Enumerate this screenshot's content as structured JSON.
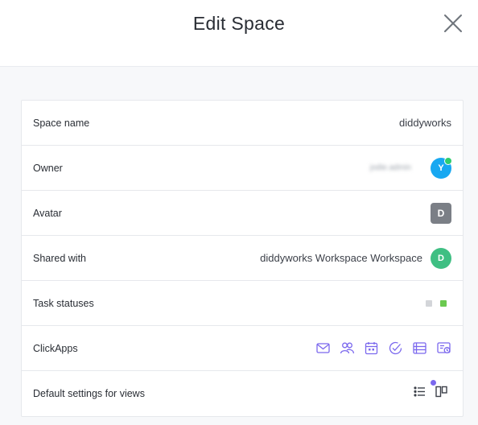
{
  "dialog": {
    "title": "Edit Space"
  },
  "rows": {
    "space_name": {
      "label": "Space name",
      "value": "diddyworks"
    },
    "owner": {
      "label": "Owner",
      "value": "jodie.admin",
      "avatar_initial": "Y",
      "avatar_color": "#18a8f1",
      "online_color": "#2ecd6f"
    },
    "avatar": {
      "label": "Avatar",
      "initial": "D",
      "color": "#7b7f86"
    },
    "shared_with": {
      "label": "Shared with",
      "value": "diddyworks Workspace Workspace",
      "avatar_initial": "D",
      "avatar_color": "#3fbf83"
    },
    "task_statuses": {
      "label": "Task statuses",
      "statuses": [
        {
          "color": "#d3d5d9"
        },
        {
          "color": "#6bc950"
        }
      ]
    },
    "clickapps": {
      "label": "ClickApps",
      "icons": [
        "email-icon",
        "people-icon",
        "calendar-icon",
        "check-circle-icon",
        "list-view-icon",
        "time-estimate-icon"
      ],
      "icon_color": "#7b68ee"
    },
    "default_views": {
      "label": "Default settings for views",
      "icons": [
        "list-icon",
        "board-icon"
      ],
      "indicator_color": "#7b68ee"
    }
  }
}
